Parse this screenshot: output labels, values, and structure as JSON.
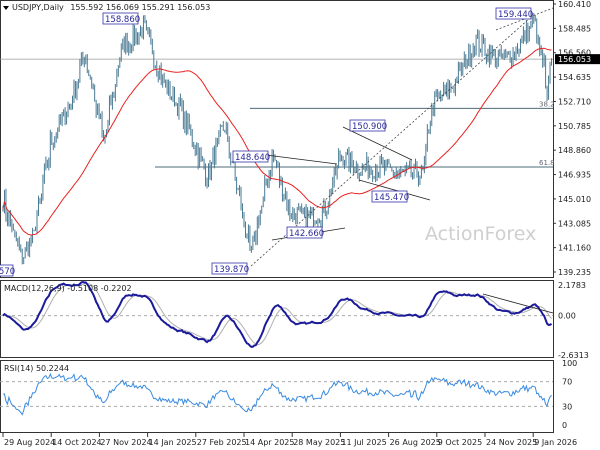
{
  "header": {
    "symbol": "USDJPY,Daily",
    "ohlc": "155.592 156.069 155.291 156.053"
  },
  "watermark": "ActionForex",
  "colors": {
    "bars": "#4a7a93",
    "ma": "#e8221f",
    "macd": "#1a1a9a",
    "signal": "#b0b0b0",
    "rsi": "#3a8be0",
    "price_tag_bg": "#000000"
  },
  "chart_data": [
    {
      "type": "ohlc",
      "title": "USDJPY,Daily",
      "ylim": [
        139.235,
        160.41
      ],
      "yticks": [
        "160.410",
        "158.485",
        "156.560",
        "154.635",
        "152.710",
        "150.785",
        "148.860",
        "146.935",
        "145.010",
        "143.085",
        "141.160",
        "139.235"
      ],
      "last_price": "156.053",
      "close_path": [
        [
          "2024-08-29",
          145.0
        ],
        [
          "2024-09-16",
          140.3
        ],
        [
          "2024-09-27",
          142.0
        ],
        [
          "2024-10-14",
          149.5
        ],
        [
          "2024-11-01",
          152.5
        ],
        [
          "2024-11-15",
          156.5
        ],
        [
          "2024-12-03",
          149.5
        ],
        [
          "2024-12-20",
          157.0
        ],
        [
          "2025-01-10",
          158.5
        ],
        [
          "2025-01-27",
          154.5
        ],
        [
          "2025-02-14",
          152.0
        ],
        [
          "2025-03-11",
          146.8
        ],
        [
          "2025-03-27",
          150.8
        ],
        [
          "2025-04-08",
          146.0
        ],
        [
          "2025-04-21",
          140.5
        ],
        [
          "2025-05-12",
          148.5
        ],
        [
          "2025-05-28",
          144.0
        ],
        [
          "2025-06-12",
          143.5
        ],
        [
          "2025-06-30",
          144.0
        ],
        [
          "2025-07-15",
          148.5
        ],
        [
          "2025-08-01",
          147.5
        ],
        [
          "2025-08-20",
          147.5
        ],
        [
          "2025-09-10",
          147.0
        ],
        [
          "2025-10-01",
          147.0
        ],
        [
          "2025-10-10",
          152.5
        ],
        [
          "2025-10-30",
          154.0
        ],
        [
          "2025-11-20",
          157.5
        ],
        [
          "2025-12-10",
          156.0
        ],
        [
          "2025-12-26",
          156.5
        ],
        [
          "2026-01-14",
          159.0
        ],
        [
          "2026-01-23",
          155.5
        ],
        [
          "2026-01-27",
          152.8
        ],
        [
          "2026-01-30",
          156.05
        ]
      ],
      "price_labels": [
        "158.860",
        "159.440",
        "150.900",
        "148.640",
        "145.470",
        "142.660",
        "139.870",
        "70"
      ],
      "fib_levels": [
        {
          "label": "38.2",
          "price": 152.16
        },
        {
          "label": "61.8",
          "price": 147.53
        }
      ]
    },
    {
      "type": "line",
      "title": "MACD(12,26,9) -0.5108 -0.2202",
      "ylim": [
        -2.6313,
        2.1783
      ],
      "yticks": [
        "2.1783",
        "0.00",
        "-2.6313"
      ]
    },
    {
      "type": "line",
      "title": "RSI(14) 50.2244",
      "ylim": [
        0,
        100
      ],
      "yticks": [
        "100",
        "70",
        "30",
        "0"
      ]
    }
  ],
  "xticks": [
    "29 Aug 2024",
    "14 Oct 2024",
    "27 Nov 2024",
    "14 Jan 2025",
    "27 Feb 2025",
    "14 Apr 2025",
    "28 May 2025",
    "11 Jul 2025",
    "26 Aug 2025",
    "9 Oct 2025",
    "24 Nov 2025",
    "9 Jan 2026"
  ]
}
